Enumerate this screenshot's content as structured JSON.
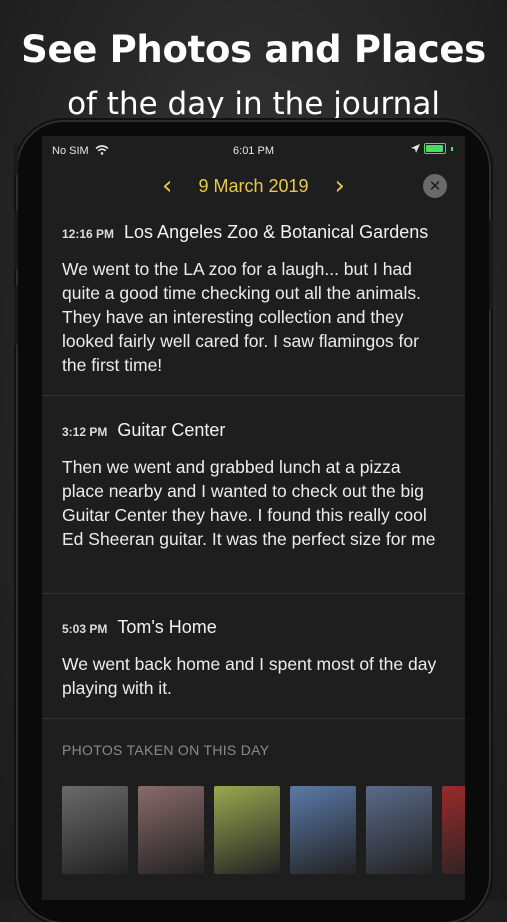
{
  "headline": {
    "line1": "See Photos and Places",
    "line2": "of the day in the journal"
  },
  "status_bar": {
    "carrier": "No SIM",
    "wifi_icon": "wifi-icon",
    "time": "6:01 PM",
    "location_icon": "location-arrow-icon",
    "battery_icon": "battery-charging-icon"
  },
  "nav": {
    "prev_icon": "chevron-left-icon",
    "date": "9 March 2019",
    "next_icon": "chevron-right-icon",
    "close_icon": "close-icon"
  },
  "entries": [
    {
      "time": "12:16 PM",
      "place": "Los Angeles Zoo & Botanical Gardens",
      "text": "We went to the LA zoo for a laugh... but I had quite a good time checking out all the animals. They have an interesting collection and they looked fairly well cared for. I saw flamingos for the first time!"
    },
    {
      "time": "3:12 PM",
      "place": "Guitar Center",
      "text": "Then we went and grabbed lunch at a pizza place nearby and I wanted to check out the big Guitar Center they have. I found this really cool Ed Sheeran guitar. It was the perfect size for me"
    },
    {
      "time": "5:03 PM",
      "place": "Tom's Home",
      "text": "We went back home and I spent most of the day playing with it."
    }
  ],
  "photos": {
    "label": "PHOTOS TAKEN ON THIS DAY",
    "items": [
      {
        "name": "photo-zoo-walkway",
        "color": "#6a6a6a"
      },
      {
        "name": "photo-flamingos",
        "color": "#8a6a6a"
      },
      {
        "name": "photo-pond",
        "color": "#9aa850"
      },
      {
        "name": "photo-trees",
        "color": "#5a7aa8"
      },
      {
        "name": "photo-theater",
        "color": "#5a6a8a"
      },
      {
        "name": "photo-red-sign",
        "color": "#9a2a2a"
      }
    ]
  },
  "colors": {
    "accent": "#e9c84a",
    "screen_bg": "#1e1e1e"
  }
}
